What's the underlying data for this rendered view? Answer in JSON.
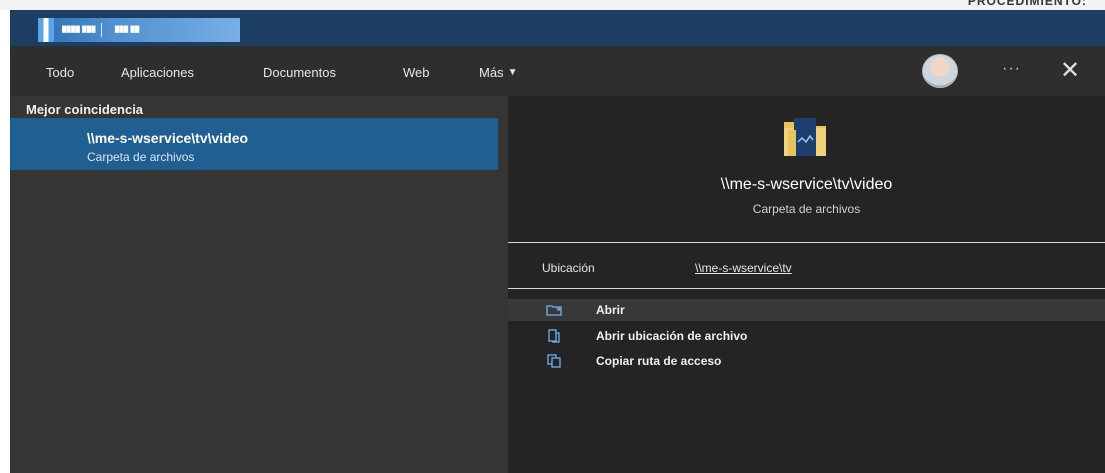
{
  "paper": {
    "header_fragment": "PROCEDIMIENTO:"
  },
  "tabs": [
    {
      "label": "Todo"
    },
    {
      "label": "Aplicaciones"
    },
    {
      "label": "Documentos"
    },
    {
      "label": "Web"
    },
    {
      "label": "Más"
    }
  ],
  "toolbar": {
    "more_options": "···",
    "close": "✕"
  },
  "results": {
    "section_heading": "Mejor coincidencia",
    "best": {
      "title": "\\\\me-s-wservice\\tv\\video",
      "subtitle": "Carpeta de archivos"
    }
  },
  "detail": {
    "title": "\\\\me-s-wservice\\tv\\video",
    "subtitle": "Carpeta de archivos",
    "location_label": "Ubicación",
    "location_value": "\\\\me-s-wservice\\tv",
    "actions": [
      {
        "label": "Abrir",
        "icon": "open-folder-icon"
      },
      {
        "label": "Abrir ubicación de archivo",
        "icon": "file-location-icon"
      },
      {
        "label": "Copiar ruta de acceso",
        "icon": "copy-path-icon"
      }
    ]
  },
  "colors": {
    "banner": "#1d3e63",
    "selection": "#1f5f92",
    "accent_icon": "#6fb3ee",
    "folder": "#e8c25a"
  }
}
